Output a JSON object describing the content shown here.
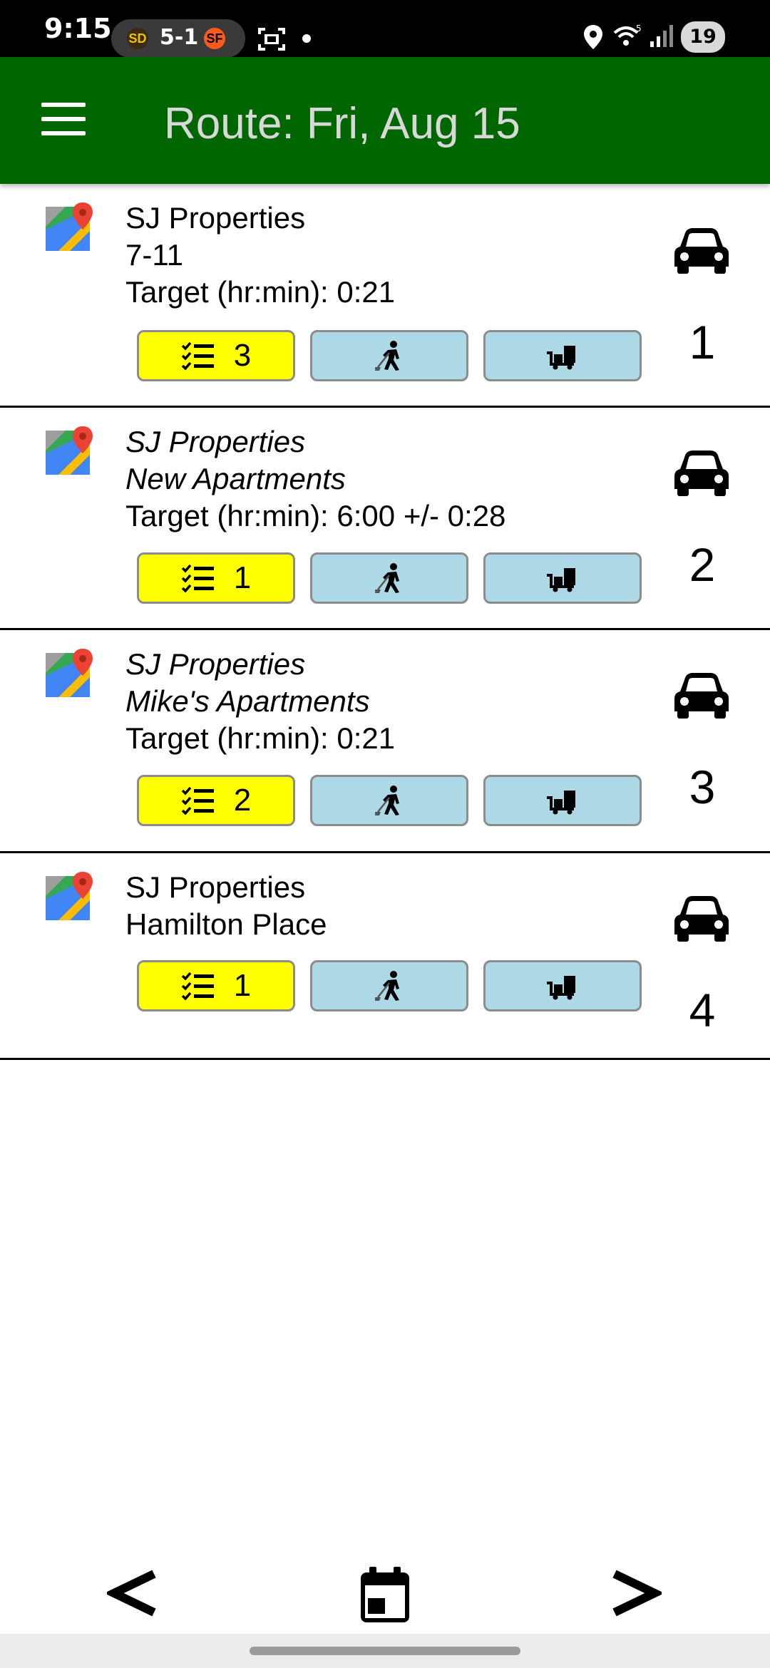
{
  "status_bar": {
    "time": "9:15",
    "score": "5-1",
    "battery": "19",
    "icons": [
      "padres-logo",
      "giants-logo",
      "screenshot-icon",
      "notification-dot",
      "location-icon",
      "wifi-icon",
      "signal-icon",
      "battery-icon"
    ]
  },
  "app_bar": {
    "title": "Route: Fri, Aug 15",
    "color": "#006600"
  },
  "stops": [
    {
      "line1": "SJ Properties",
      "line2": "7-11",
      "target": "Target (hr:min):  0:21",
      "task_count": "3",
      "number": "1",
      "italic": false
    },
    {
      "line1": "SJ Properties",
      "line2": "New Apartments",
      "target": "Target (hr:min):  6:00 +/- 0:28",
      "task_count": "1",
      "number": "2",
      "italic": true
    },
    {
      "line1": "SJ Properties",
      "line2": "Mike's Apartments",
      "target": "Target (hr:min):  0:21",
      "task_count": "2",
      "number": "3",
      "italic": true
    },
    {
      "line1": "SJ Properties",
      "line2": "Hamilton Place",
      "target": "",
      "task_count": "1",
      "number": "4",
      "italic": false
    }
  ],
  "bottom_nav": {
    "prev": "<",
    "next": ">",
    "calendar_icon": "calendar-icon"
  },
  "colors": {
    "tasks_button": "#ffff00",
    "action_button": "#add8e6"
  }
}
